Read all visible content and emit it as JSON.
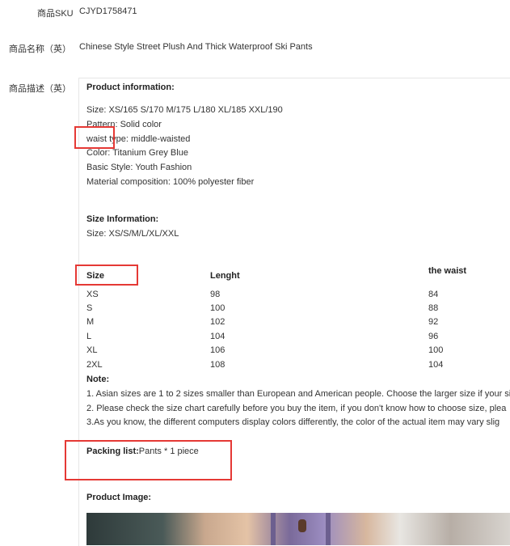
{
  "fields": {
    "sku_label": "商品SKU",
    "sku_value": "CJYD1758471",
    "name_label": "商品名称（英）",
    "name_value": "Chinese Style Street Plush And Thick Waterproof Ski Pants",
    "desc_label": "商品描述（英）"
  },
  "description": {
    "product_info_title": "Product information:",
    "product_info_lines": [
      "Size: XS/165 S/170 M/175 L/180 XL/185 XXL/190",
      "Pattern: Solid color",
      "waist type: middle-waisted",
      "Color: Titanium Grey Blue",
      "Basic Style: Youth Fashion",
      "Material composition: 100% polyester fiber"
    ],
    "size_info_title": "Size Information:",
    "size_info_line": "Size: XS/S/M/L/XL/XXL",
    "size_table": {
      "headers": [
        "Size",
        "Lenght",
        "the waist"
      ],
      "rows": [
        [
          "XS",
          "98",
          "84"
        ],
        [
          "S",
          "100",
          "88"
        ],
        [
          "M",
          "102",
          "92"
        ],
        [
          "L",
          "104",
          "96"
        ],
        [
          "XL",
          "106",
          "100"
        ],
        [
          "2XL",
          "108",
          "104"
        ]
      ]
    },
    "note_title": "Note:",
    "notes": [
      "1. Asian sizes are 1 to 2 sizes smaller than European and American people. Choose the larger size if your si",
      "2. Please check the size chart carefully before you buy the item, if you don't know how to choose size, plea",
      "3.As you know, the different computers display colors differently, the color of the actual item may vary slig"
    ],
    "packing_title": "Packing list:",
    "packing_value": "Pants * 1 piece",
    "product_image_title": "Product Image:"
  },
  "colors": {
    "highlight_red": "#e53935"
  }
}
